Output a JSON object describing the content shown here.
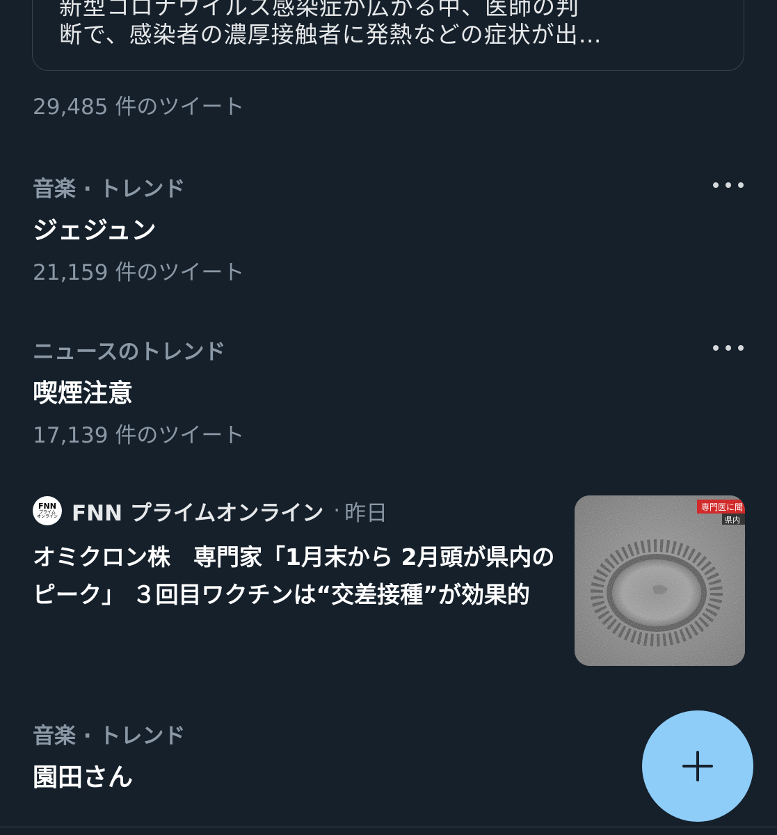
{
  "quoted_card": {
    "text_partial_top": "新型コロナウイルス感染症が広がる中、医師の判",
    "text_line": "断で、感染者の濃厚接触者に発熱などの症状が出…"
  },
  "first_count": "29,485 件のツイート",
  "trends": [
    {
      "context": "音楽 · トレンド",
      "name": "ジェジュン",
      "count": "21,159 件のツイート",
      "more_icon": "ellipsis-icon"
    },
    {
      "context": "ニュースのトレンド",
      "name": "喫煙注意",
      "count": "17,139 件のツイート",
      "more_icon": "ellipsis-icon"
    },
    {
      "context": "音楽 · トレンド",
      "name": "園田さん"
    }
  ],
  "news_story": {
    "source_logo_lines": [
      "FNN",
      "プライム",
      "オンライン"
    ],
    "source_name": "FNN プライムオンライン",
    "separator": "·",
    "time": "昨日",
    "headline": "オミクロン株　専門家「1月末から 2月頭が県内のピーク」 ３回目ワクチンは“交差接種”が効果的",
    "thumbnail_caption_1": "専門医に聞",
    "thumbnail_caption_2": "県内"
  },
  "fab": {
    "icon": "plus-icon"
  },
  "colors": {
    "background": "#15202b",
    "secondary_text": "#8b98a5",
    "fab": "#8ecdf8",
    "border": "#38444d"
  }
}
